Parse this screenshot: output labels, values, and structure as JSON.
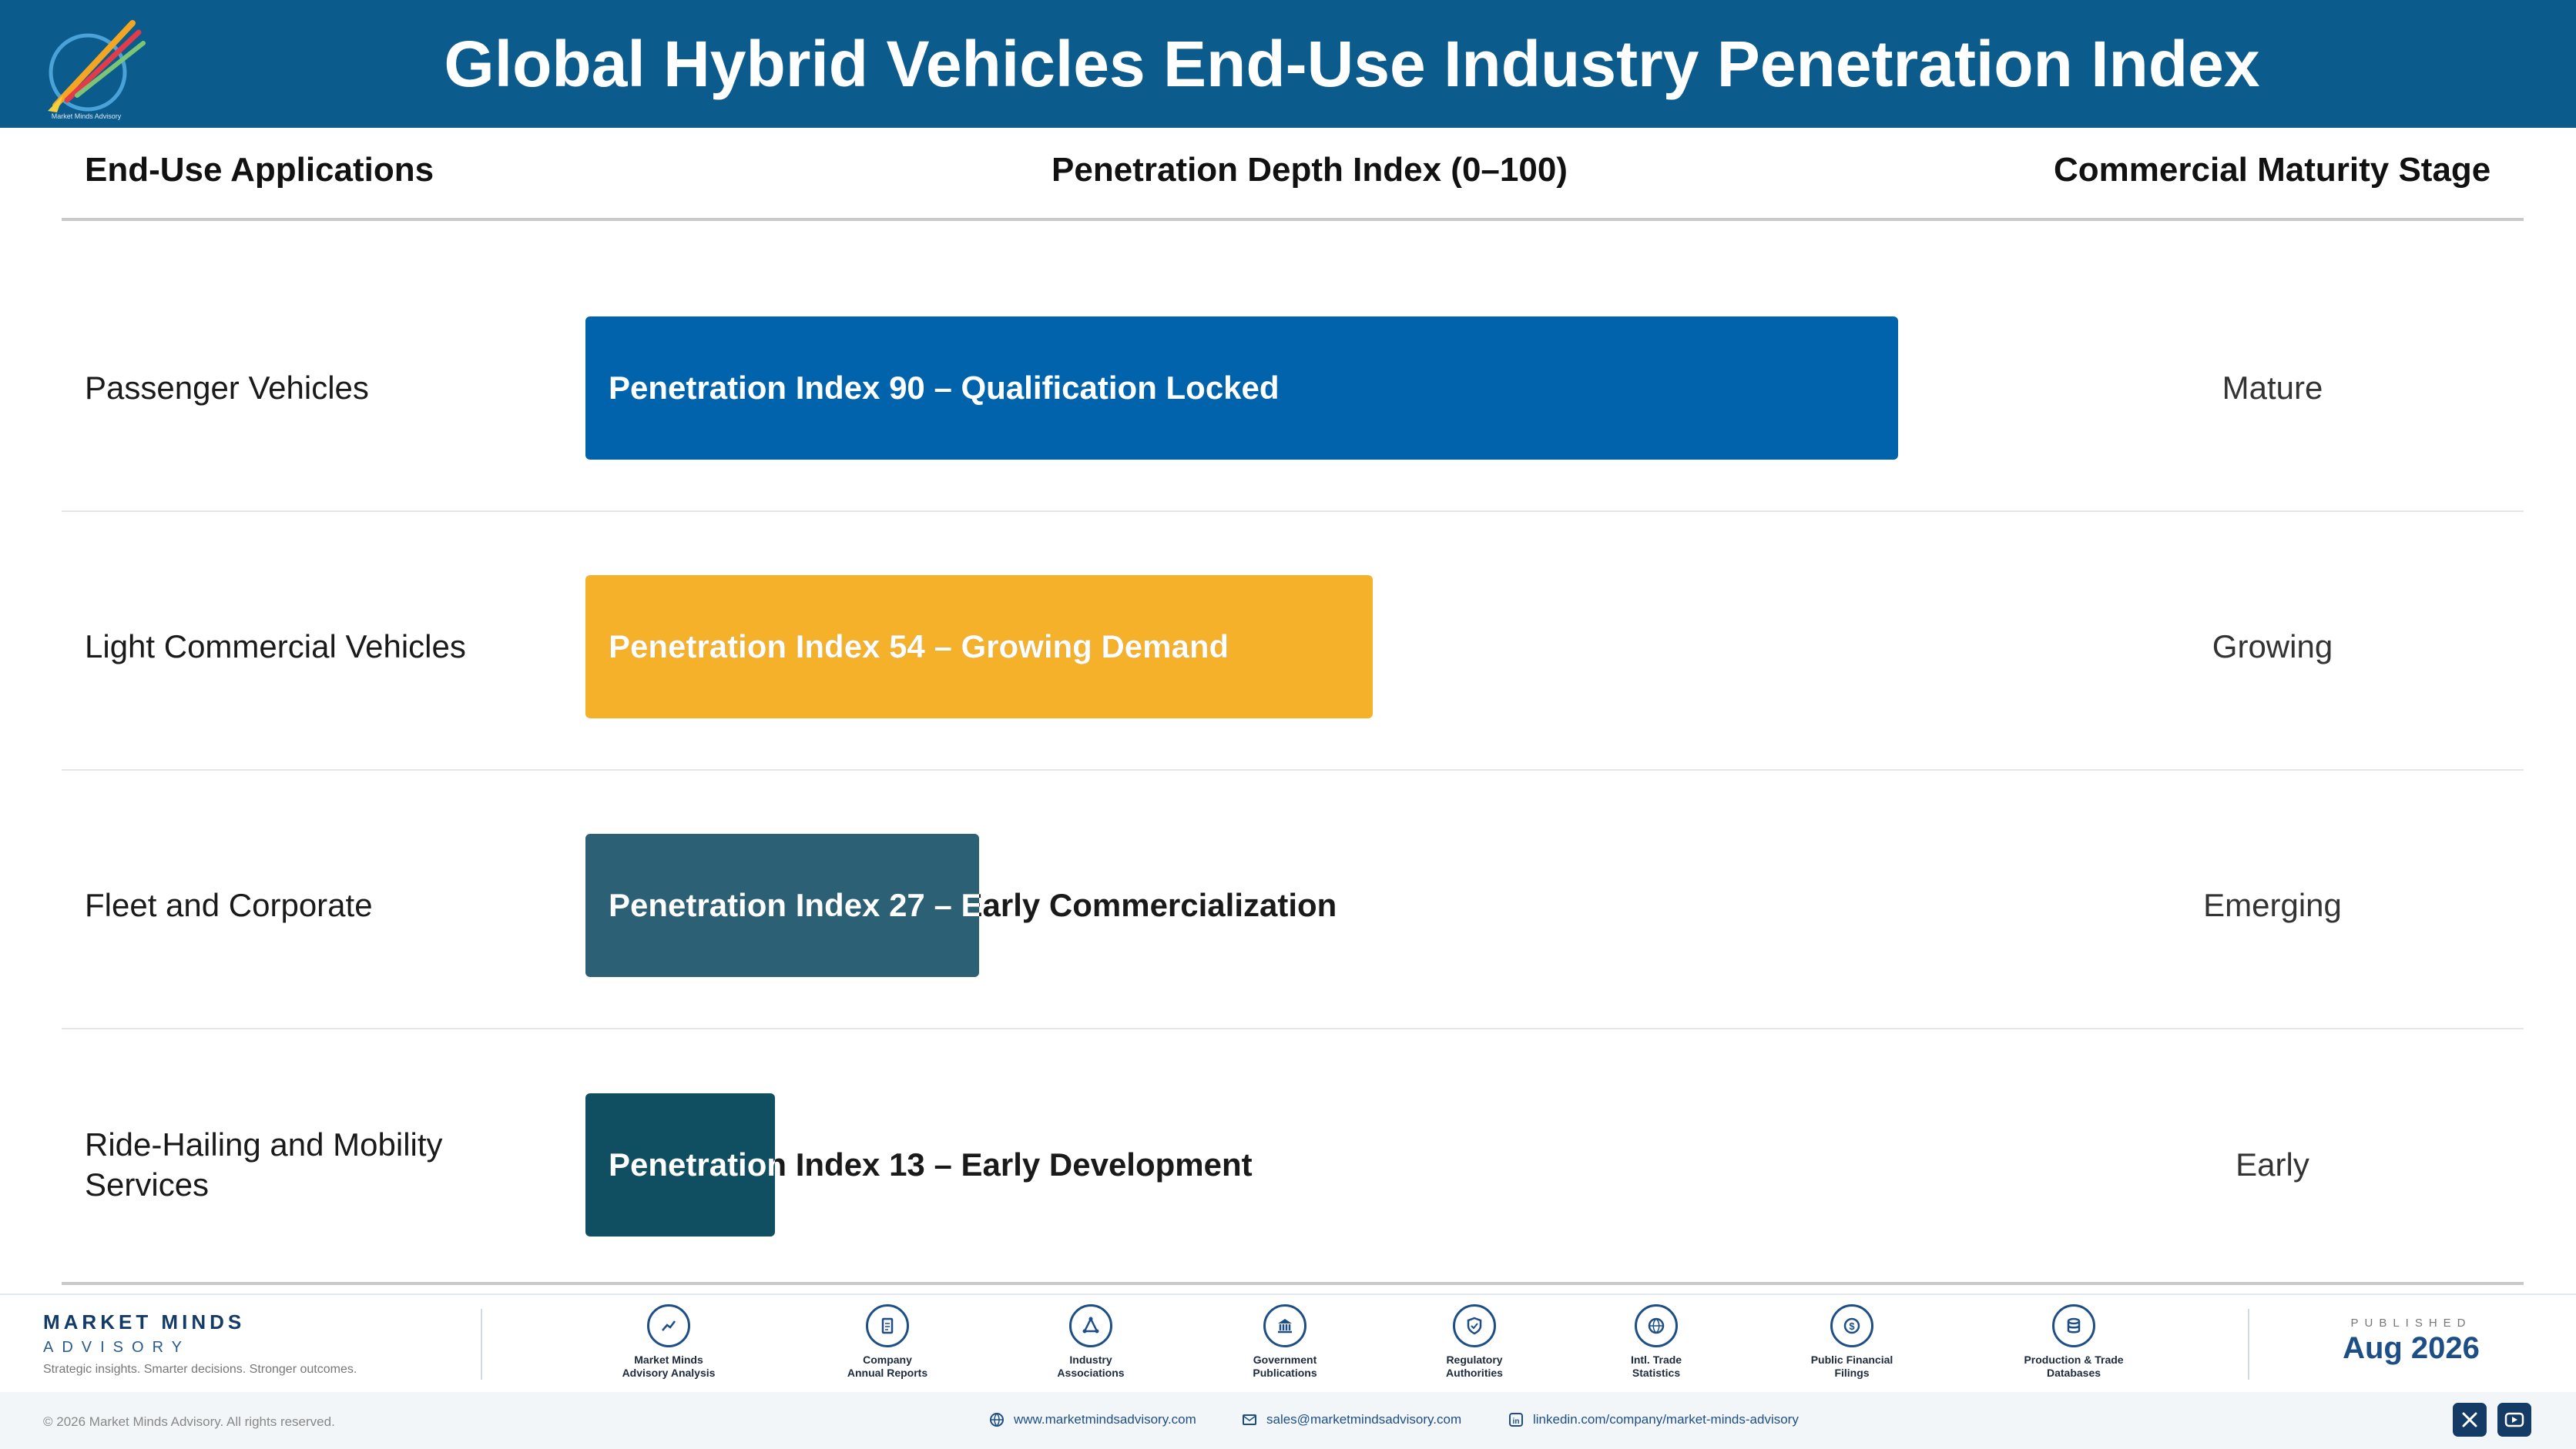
{
  "header": {
    "title": "Global Hybrid Vehicles End-Use Industry Penetration Index",
    "logo_text": "Market Minds Advisory"
  },
  "columns": {
    "applications": "End-Use Applications",
    "depth": "Penetration Depth Index (0–100)",
    "stage": "Commercial Maturity Stage"
  },
  "chart_data": {
    "type": "bar",
    "orientation": "horizontal",
    "xlim": [
      0,
      100
    ],
    "categories": [
      "Passenger Vehicles",
      "Light Commercial Vehicles",
      "Fleet and Corporate",
      "Ride-Hailing and Mobility Services"
    ],
    "values": [
      90,
      54,
      27,
      13
    ],
    "labels": [
      "Penetration Index 90 – Qualification Locked",
      "Penetration Index 54 – Growing Demand",
      "Penetration Index 27 – Early Commercialization",
      "Penetration Index 13 – Early Development"
    ],
    "stages": [
      "Mature",
      "Growing",
      "Emerging",
      "Early"
    ],
    "colors": [
      "#0063ab",
      "#f6b12a",
      "#2b6075",
      "#0f4f61"
    ],
    "grid": false
  },
  "footer": {
    "brand_name": "MARKET MINDS",
    "brand_sub": "ADVISORY",
    "tagline": "Strategic insights. Smarter decisions. Stronger outcomes.",
    "sources": [
      {
        "line1": "Market Minds",
        "line2": "Advisory Analysis",
        "icon": "trend-icon"
      },
      {
        "line1": "Company",
        "line2": "Annual Reports",
        "icon": "document-icon"
      },
      {
        "line1": "Industry",
        "line2": "Associations",
        "icon": "network-icon"
      },
      {
        "line1": "Government",
        "line2": "Publications",
        "icon": "bank-icon"
      },
      {
        "line1": "Regulatory",
        "line2": "Authorities",
        "icon": "shield-icon"
      },
      {
        "line1": "Intl. Trade",
        "line2": "Statistics",
        "icon": "globe-icon"
      },
      {
        "line1": "Public Financial",
        "line2": "Filings",
        "icon": "dollar-icon"
      },
      {
        "line1": "Production & Trade",
        "line2": "Databases",
        "icon": "database-icon"
      }
    ],
    "published_label": "PUBLISHED",
    "published_date": "Aug 2026",
    "copyright": "© 2026 Market Minds Advisory. All rights reserved.",
    "website": "www.marketmindsadvisory.com",
    "email": "sales@marketmindsadvisory.com",
    "linkedin": "linkedin.com/company/market-minds-advisory"
  }
}
